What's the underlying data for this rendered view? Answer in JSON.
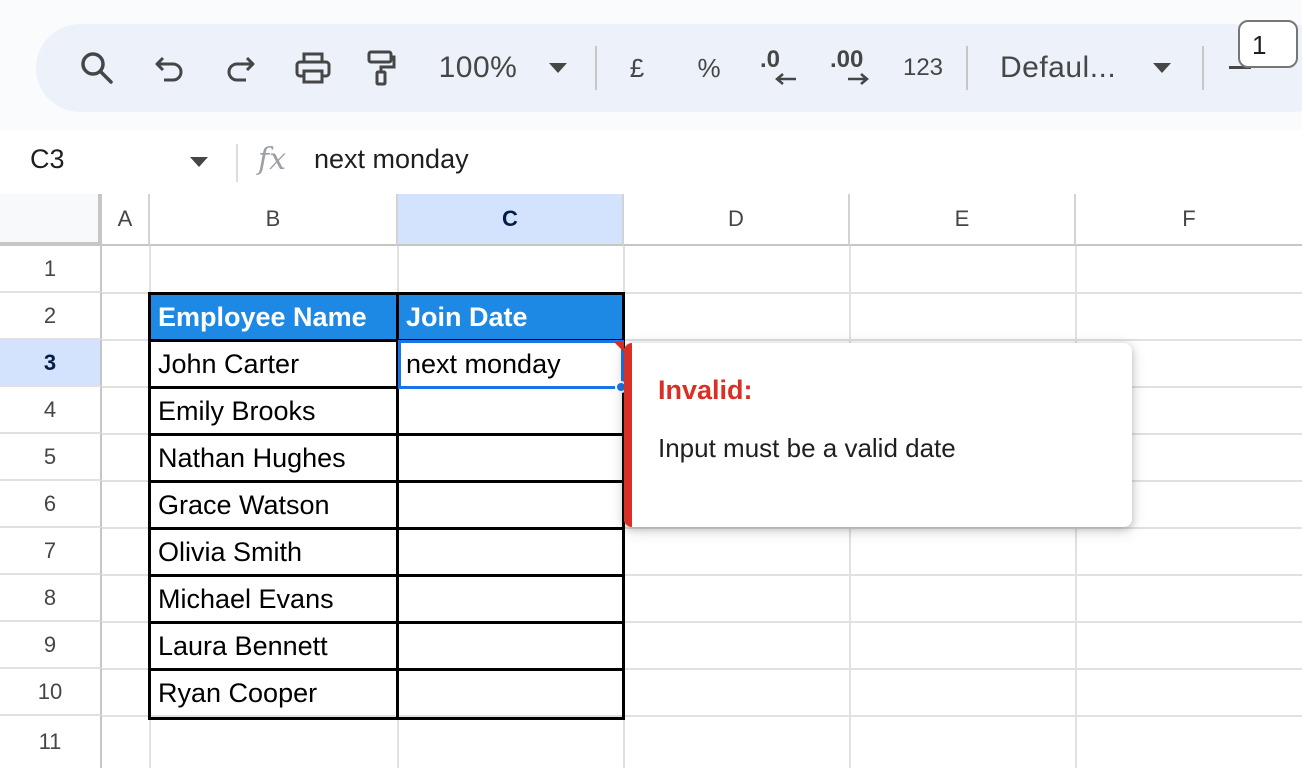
{
  "toolbar": {
    "zoom": "100%",
    "currency": "£",
    "percent": "%",
    "decrease_decimal": ".0",
    "increase_decimal": ".00",
    "number_format": "123",
    "font": "Defaul...",
    "font_size": "1",
    "minus": "−"
  },
  "formula_bar": {
    "cell_ref": "C3",
    "fx": "fx",
    "content": "next monday"
  },
  "columns": [
    "A",
    "B",
    "C",
    "D",
    "E",
    "F"
  ],
  "rows": [
    "1",
    "2",
    "3",
    "4",
    "5",
    "6",
    "7",
    "8",
    "9",
    "10",
    "11"
  ],
  "table": {
    "headers": [
      "Employee Name",
      "Join Date"
    ],
    "rows": [
      [
        "John Carter",
        "next monday"
      ],
      [
        "Emily Brooks",
        ""
      ],
      [
        "Nathan Hughes",
        ""
      ],
      [
        "Grace Watson",
        ""
      ],
      [
        "Olivia Smith",
        ""
      ],
      [
        "Michael Evans",
        ""
      ],
      [
        "Laura Bennett",
        ""
      ],
      [
        "Ryan Cooper",
        ""
      ]
    ]
  },
  "validation_popup": {
    "title": "Invalid:",
    "message": "Input must be a valid date"
  },
  "colors": {
    "header_fill": "#1e88e5",
    "selection": "#1a73e8",
    "error": "#d93025"
  }
}
